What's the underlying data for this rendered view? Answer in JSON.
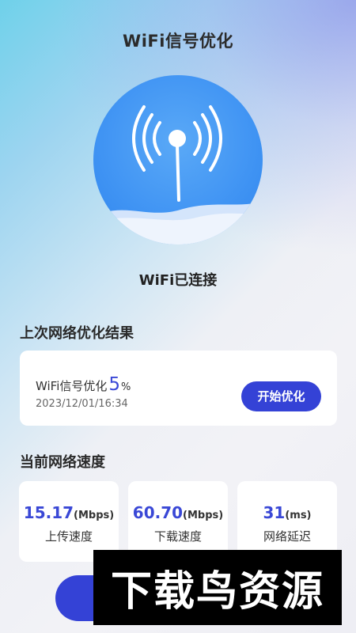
{
  "header": {
    "title": "WiFi信号优化"
  },
  "wifi": {
    "icon": "wifi-signal-icon",
    "status": "WiFi已连接"
  },
  "last_result": {
    "section_title": "上次网络优化结果",
    "label": "WiFi信号优化",
    "percent": "5",
    "percent_unit": "%",
    "timestamp": "2023/12/01/16:34",
    "button_label": "开始优化"
  },
  "current_speed": {
    "section_title": "当前网络速度",
    "items": [
      {
        "value": "15.17",
        "unit": "(Mbps)",
        "label": "上传速度"
      },
      {
        "value": "60.70",
        "unit": "(Mbps)",
        "label": "下载速度"
      },
      {
        "value": "31",
        "unit": "(ms)",
        "label": "网络延迟"
      }
    ]
  },
  "watermark": {
    "text": "下载鸟资源"
  },
  "colors": {
    "accent": "#3442d6",
    "circle": "#3f93f3"
  }
}
